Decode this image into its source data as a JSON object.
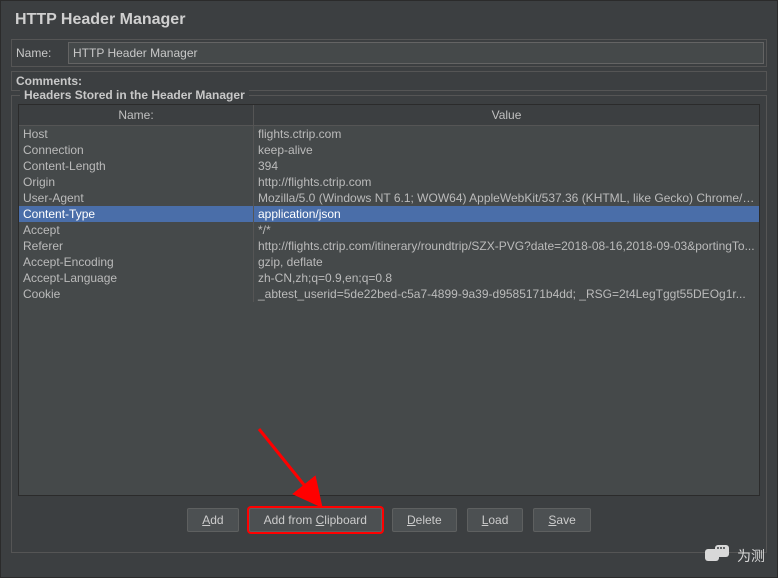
{
  "title": "HTTP Header Manager",
  "nameLabel": "Name:",
  "nameValue": "HTTP Header Manager",
  "commentsLabel": "Comments:",
  "groupTitle": "Headers Stored in the Header Manager",
  "columns": {
    "name": "Name:",
    "value": "Value"
  },
  "headers": [
    {
      "name": "Host",
      "value": "flights.ctrip.com"
    },
    {
      "name": "Connection",
      "value": "keep-alive"
    },
    {
      "name": "Content-Length",
      "value": "394"
    },
    {
      "name": "Origin",
      "value": "http://flights.ctrip.com"
    },
    {
      "name": "User-Agent",
      "value": "Mozilla/5.0 (Windows NT 6.1; WOW64) AppleWebKit/537.36 (KHTML, like Gecko) Chrome/6..."
    },
    {
      "name": "Content-Type",
      "value": "application/json",
      "selected": true
    },
    {
      "name": "Accept",
      "value": "*/*"
    },
    {
      "name": "Referer",
      "value": "http://flights.ctrip.com/itinerary/roundtrip/SZX-PVG?date=2018-08-16,2018-09-03&portingTo..."
    },
    {
      "name": "Accept-Encoding",
      "value": "gzip, deflate"
    },
    {
      "name": "Accept-Language",
      "value": "zh-CN,zh;q=0.9,en;q=0.8"
    },
    {
      "name": "Cookie",
      "value": "_abtest_userid=5de22bed-c5a7-4899-9a39-d9585171b4dd; _RSG=2t4LegTggt55DEOg1r..."
    }
  ],
  "buttons": {
    "add": "Add",
    "addFromClipboard": "Add from Clipboard",
    "delete": "Delete",
    "load": "Load",
    "save": "Save"
  },
  "watermark": "为测"
}
